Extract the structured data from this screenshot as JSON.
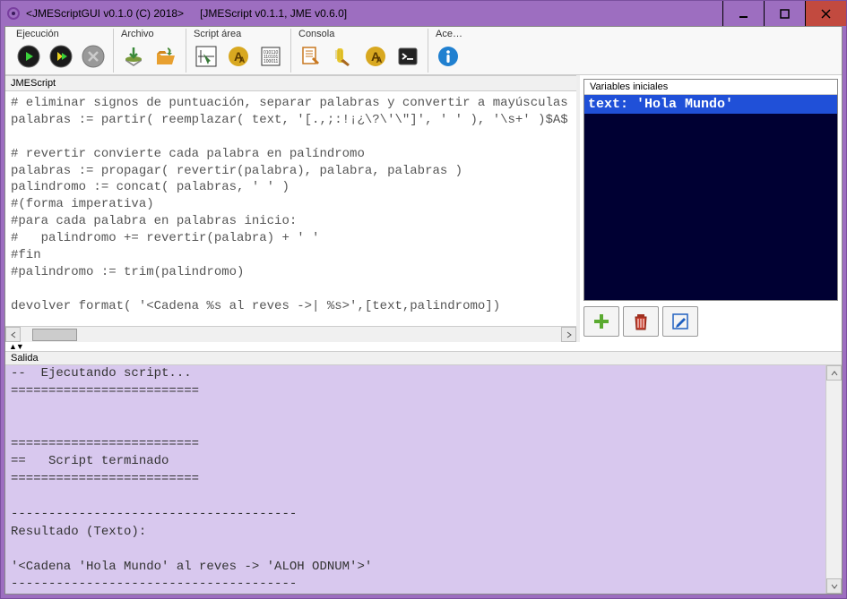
{
  "titlebar": {
    "title1": "<JMEScriptGUI v0.1.0  (C) 2018>",
    "title2": "[JMEScript v0.1.1, JME v0.6.0]"
  },
  "toolbar": {
    "groups": {
      "ejecucion": "Ejecución",
      "archivo": "Archivo",
      "script_area": "Script área",
      "consola": "Consola",
      "ace": "Ace…"
    }
  },
  "panes": {
    "script_title": "JMEScript",
    "vars_title": "Variables iniciales",
    "output_title": "Salida"
  },
  "script_code": "# eliminar signos de puntuación, separar palabras y convertir a mayúsculas\npalabras := partir( reemplazar( text, '[.,;:!¡¿\\?\\'\\\"]', ' ' ), '\\s+' )$A$\n\n# revertir convierte cada palabra en palíndromo\npalabras := propagar( revertir(palabra), palabra, palabras )\npalindromo := concat( palabras, ' ' )\n#(forma imperativa)\n#para cada palabra en palabras inicio:\n#   palindromo += revertir(palabra) + ' '\n#fin\n#palindromo := trim(palindromo)\n\ndevolver format( '<Cadena %s al reves ->| %s>',[text,palindromo])",
  "variables": {
    "row1": "text:   'Hola Mundo'"
  },
  "output_text": "--  Ejecutando script...\n=========================\n\n\n=========================\n==   Script terminado\n=========================\n\n--------------------------------------\nResultado (Texto):\n\n'<Cadena 'Hola Mundo' al reves -> 'ALOH ODNUM'>'\n--------------------------------------"
}
